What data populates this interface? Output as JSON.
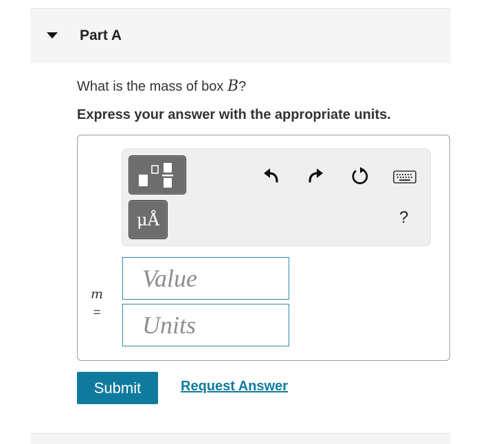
{
  "part": {
    "title": "Part A"
  },
  "question": {
    "prefix": "What is the mass of box ",
    "variable": "B",
    "suffix": "?"
  },
  "instruction": "Express your answer with the appropriate units.",
  "toolbar": {
    "templates_icon": "fraction-superscript-template-icon",
    "units_label": "μÅ",
    "undo_icon": "undo-icon",
    "redo_icon": "redo-icon",
    "reset_icon": "reset-icon",
    "keyboard_icon": "keyboard-icon",
    "help_label": "?"
  },
  "answer": {
    "variable": "m",
    "equals": "=",
    "value_placeholder": "Value",
    "units_placeholder": "Units"
  },
  "actions": {
    "submit_label": "Submit",
    "request_label": "Request Answer"
  },
  "colors": {
    "accent": "#0f7a9e",
    "field_border": "#2a8aa6",
    "header_bg": "#f5f5f5"
  }
}
